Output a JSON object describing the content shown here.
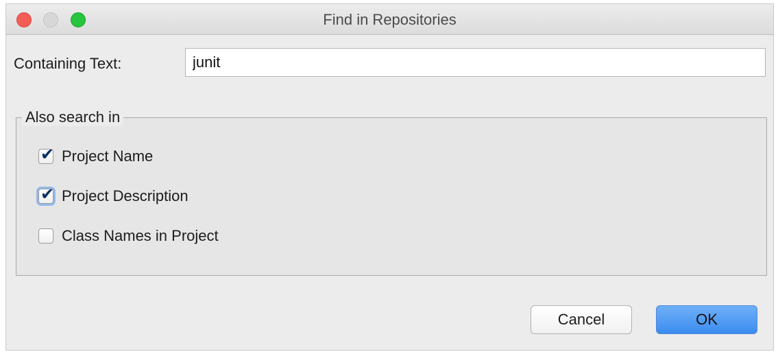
{
  "window": {
    "title": "Find in Repositories"
  },
  "search": {
    "label": "Containing Text:",
    "value": "junit"
  },
  "group": {
    "legend": "Also search in",
    "options": [
      {
        "label": "Project Name",
        "checked": true
      },
      {
        "label": "Project Description",
        "checked": true
      },
      {
        "label": "Class Names in Project",
        "checked": false
      }
    ]
  },
  "buttons": {
    "cancel_label": "Cancel",
    "ok_label": "OK"
  },
  "icons": {
    "close": "close-traffic-light-icon",
    "minimize": "minimize-traffic-light-icon",
    "zoom": "zoom-traffic-light-icon",
    "check": "checkmark-icon"
  },
  "colors": {
    "close": "#f25d56",
    "minimize": "#d7d7d7",
    "zoom": "#27c43f",
    "ok_button": "#3c8cf0"
  }
}
